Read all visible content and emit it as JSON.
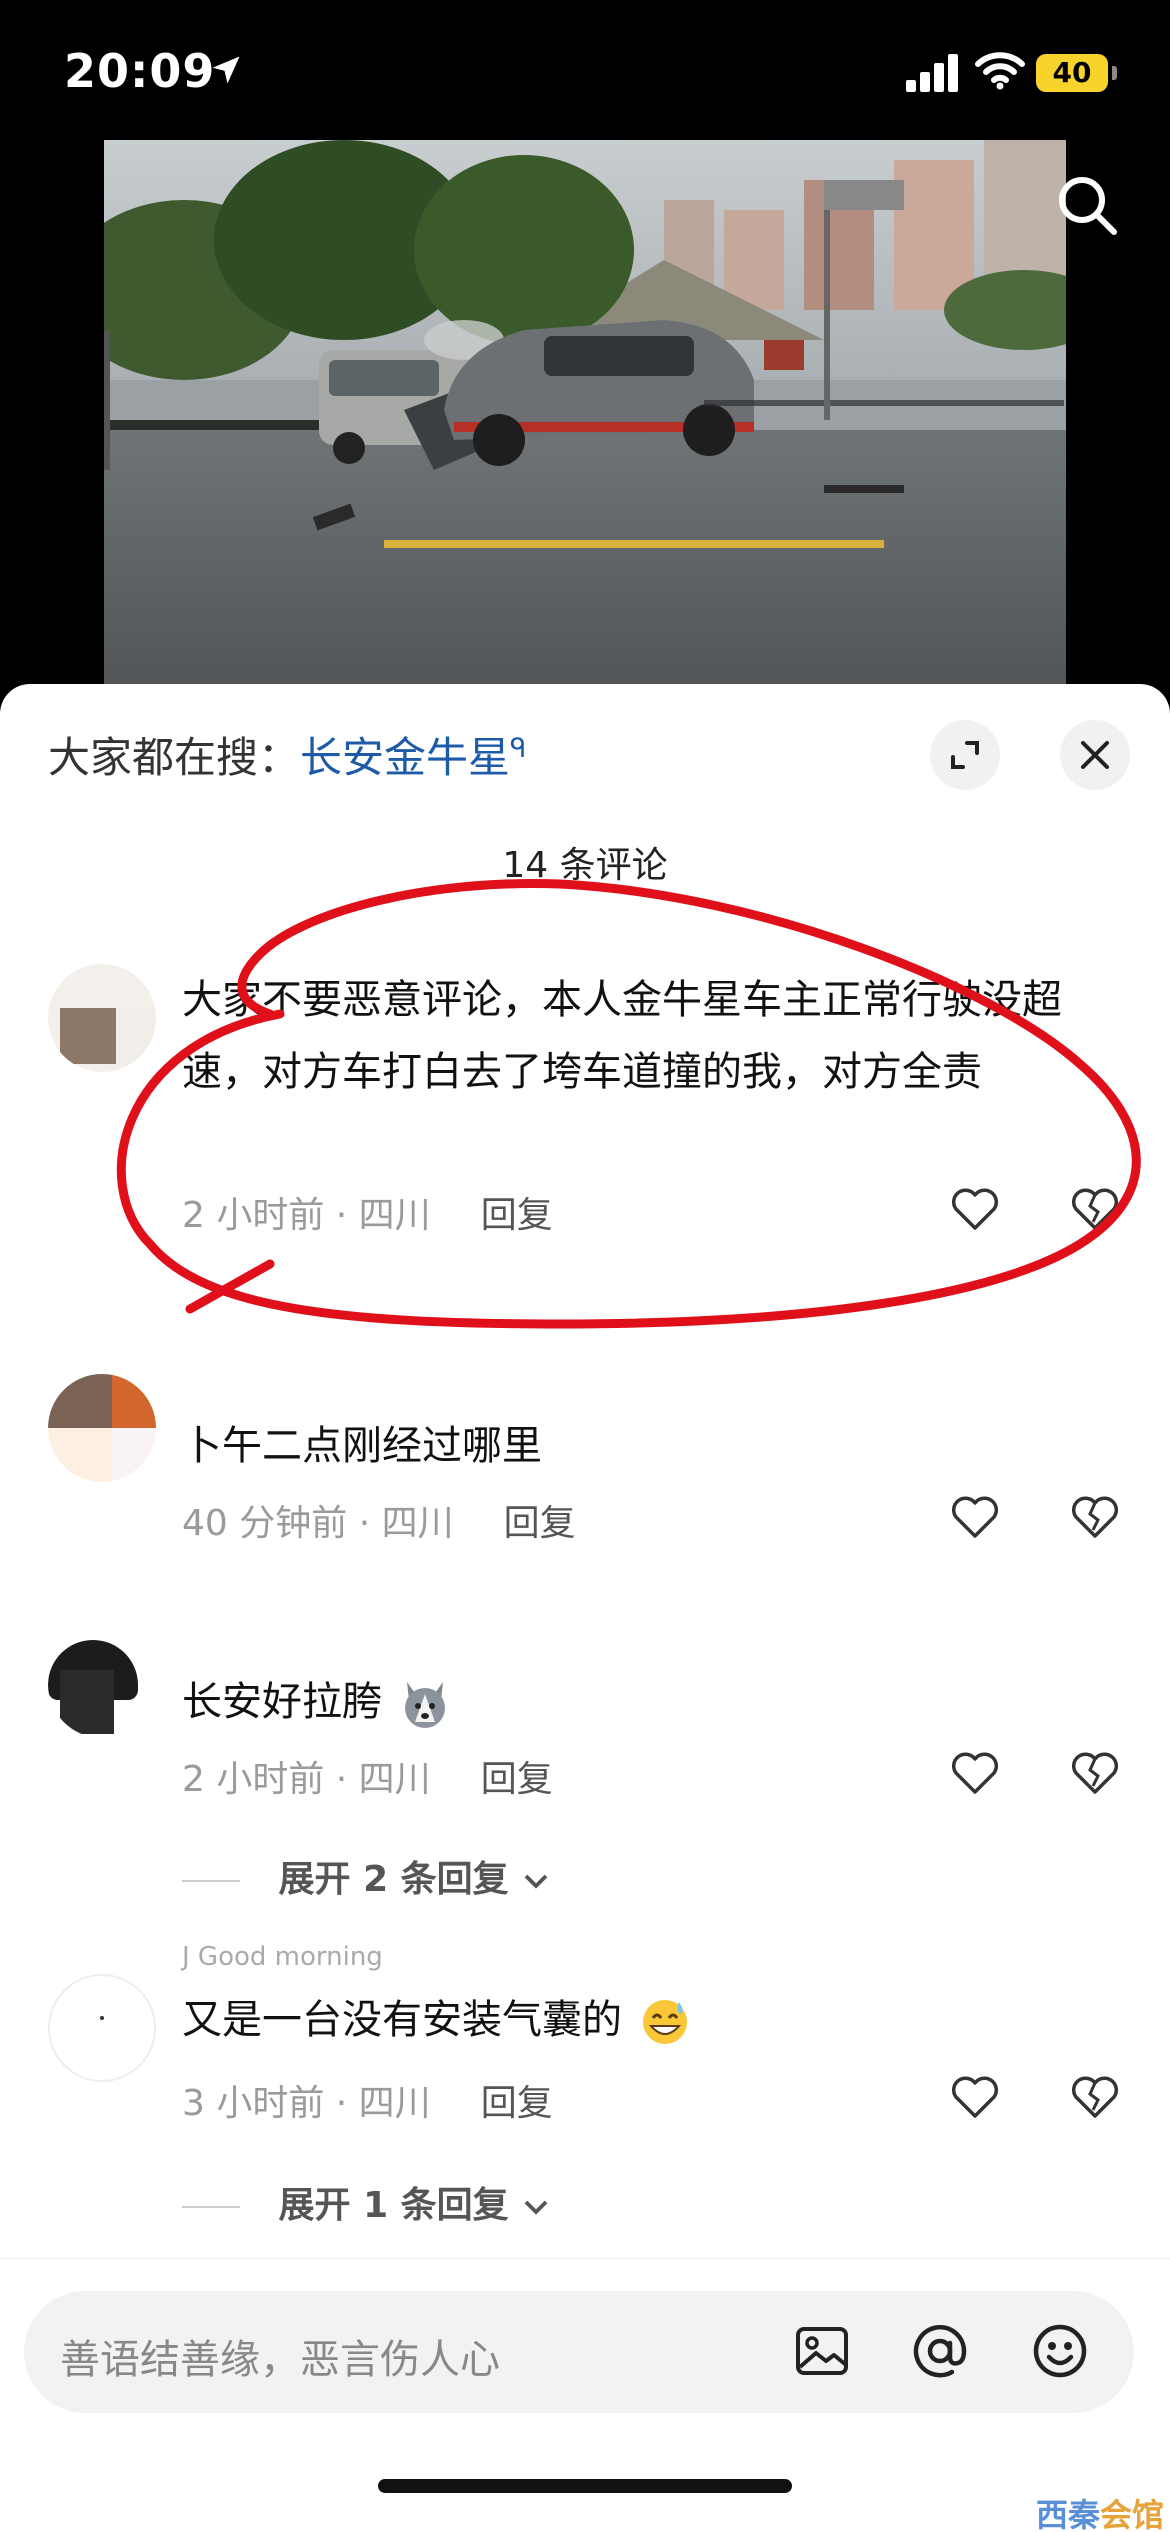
{
  "status_bar": {
    "time": "20:09",
    "battery": "40"
  },
  "search_hint": {
    "prefix": "大家都在搜：",
    "keyword": "长安金牛星",
    "search_glyph": "ᑫ"
  },
  "comment_count": "14 条评论",
  "comments": [
    {
      "text": "大家不要恶意评论，本人金牛星车主正常行驶没超速，对方车打白去了垮车道撞的我，对方全责",
      "time_location": "2 小时前 · 四川",
      "reply_label": "回复"
    },
    {
      "text": "卜午二点刚经过哪里",
      "time_location": "40 分钟前 · 四川",
      "reply_label": "回复"
    },
    {
      "text": "长安好拉胯",
      "time_location": "2 小时前 · 四川",
      "reply_label": "回复",
      "expand_replies": "展开 2 条回复"
    },
    {
      "partial_name": "J Good morning",
      "text": "又是一台没有安装气囊的",
      "time_location": "3 小时前 · 四川",
      "reply_label": "回复",
      "expand_replies": "展开 1 条回复"
    }
  ],
  "input": {
    "placeholder": "善语结善缘，恶言伤人心"
  },
  "watermark": {
    "part1": "西秦",
    "part2": "会馆"
  },
  "icons": [
    "location-arrow-icon",
    "signal-icon",
    "wifi-icon",
    "battery-icon",
    "search-icon",
    "expand-icon",
    "close-icon",
    "heart-icon",
    "broken-heart-icon",
    "image-icon",
    "at-icon",
    "emoji-icon",
    "chevron-down-icon"
  ],
  "colors": {
    "keyword_blue": "#1d5aa8",
    "annotation_red": "#e0101a",
    "battery_yellow": "#f7d32b"
  }
}
